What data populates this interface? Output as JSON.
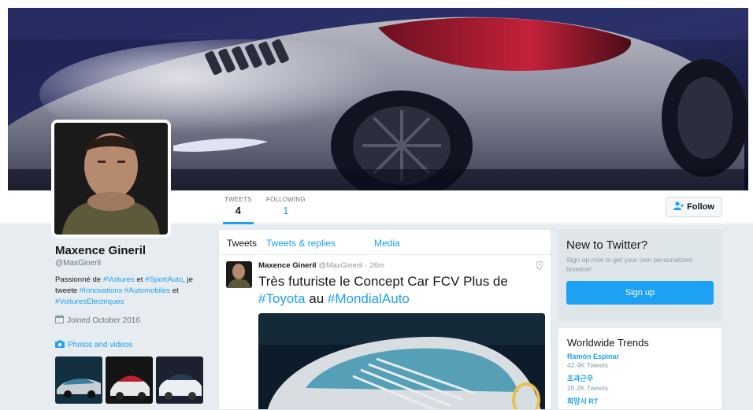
{
  "profile": {
    "name": "Maxence Gineril",
    "handle": "@MaxGineril",
    "bio_parts": {
      "p1": "Passionné de ",
      "tag1": "#Voitures",
      "p2": " et ",
      "tag2": "#SportAuto",
      "p3": ", je tweete ",
      "tag3": "#Innovations",
      "p4": " ",
      "tag4": "#Automobiles",
      "p5": " et ",
      "tag5": "#VoituresElectriques"
    },
    "joined": "Joined October 2016",
    "photos_link": "Photos and videos"
  },
  "stats": {
    "tweets_label": "TWEETS",
    "tweets_value": "4",
    "following_label": "FOLLOWING",
    "following_value": "1"
  },
  "follow_button": {
    "label": "Follow"
  },
  "timeline": {
    "tabs": [
      "Tweets",
      "Tweets & replies",
      "Media"
    ],
    "tweet": {
      "name": "Maxence Gineril",
      "handle": "@MaxGineril",
      "sep": "·",
      "time": "26m",
      "text_parts": {
        "t1": "Très futuriste le Concept Car FCV Plus de ",
        "tag1": "#Toyota",
        "t2": " au ",
        "tag2": "#MondialAuto"
      }
    }
  },
  "signup_card": {
    "heading": "New to Twitter?",
    "text": "Sign up now to get your own personalized timeline!",
    "button": "Sign up"
  },
  "trends": {
    "heading": "Worldwide Trends",
    "items": [
      {
        "name": "Ramón Espinar",
        "count": "42.4K Tweets"
      },
      {
        "name": "초과근무",
        "count": "20.2K Tweets"
      },
      {
        "name": "희망시 RT",
        "count": ""
      }
    ]
  },
  "icons": {
    "follow": "add-user-icon",
    "joined": "calendar-icon",
    "photos": "camera-icon",
    "pin": "location-pin-icon"
  },
  "colors": {
    "accent": "#1da1f2",
    "page_bg": "#e6ecf0",
    "signup_bg": "#dfe6ea"
  }
}
